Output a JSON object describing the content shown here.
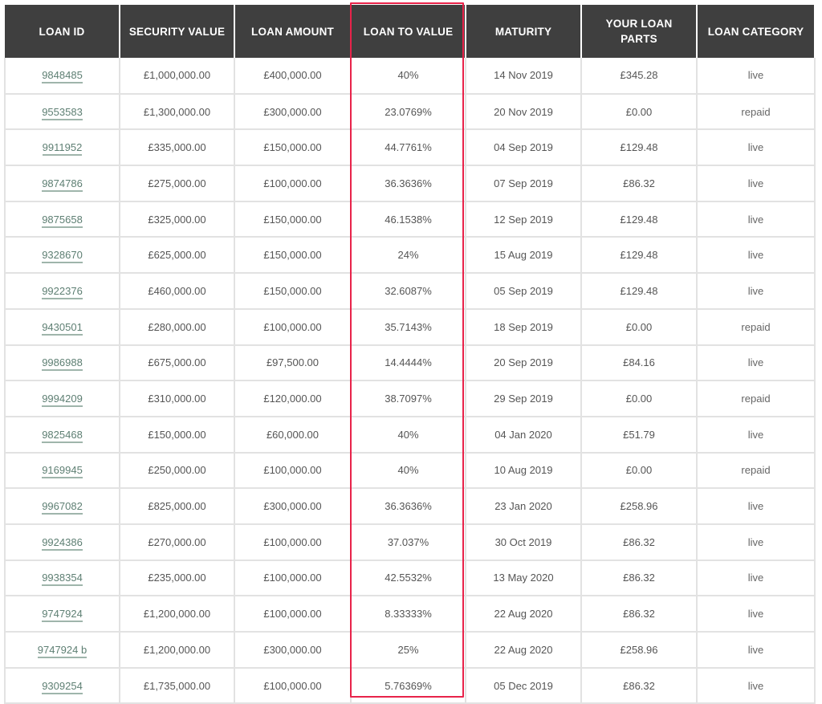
{
  "table": {
    "headers": [
      "LOAN ID",
      "SECURITY VALUE",
      "LOAN AMOUNT",
      "LOAN TO VALUE",
      "MATURITY",
      "YOUR LOAN PARTS",
      "LOAN CATEGORY"
    ],
    "highlighted_column": "LOAN TO VALUE",
    "highlight_color": "#e8234a",
    "header_bg": "#3f3f3f",
    "link_color": "#5e7f73",
    "rows": [
      {
        "loan_id": "9848485",
        "security_value": "£1,000,000.00",
        "loan_amount": "£400,000.00",
        "loan_to_value": "40%",
        "maturity": "14 Nov 2019",
        "your_loan_parts": "£345.28",
        "loan_category": "live"
      },
      {
        "loan_id": "9553583",
        "security_value": "£1,300,000.00",
        "loan_amount": "£300,000.00",
        "loan_to_value": "23.0769%",
        "maturity": "20 Nov 2019",
        "your_loan_parts": "£0.00",
        "loan_category": "repaid"
      },
      {
        "loan_id": "9911952",
        "security_value": "£335,000.00",
        "loan_amount": "£150,000.00",
        "loan_to_value": "44.7761%",
        "maturity": "04 Sep 2019",
        "your_loan_parts": "£129.48",
        "loan_category": "live"
      },
      {
        "loan_id": "9874786",
        "security_value": "£275,000.00",
        "loan_amount": "£100,000.00",
        "loan_to_value": "36.3636%",
        "maturity": "07 Sep 2019",
        "your_loan_parts": "£86.32",
        "loan_category": "live"
      },
      {
        "loan_id": "9875658",
        "security_value": "£325,000.00",
        "loan_amount": "£150,000.00",
        "loan_to_value": "46.1538%",
        "maturity": "12 Sep 2019",
        "your_loan_parts": "£129.48",
        "loan_category": "live"
      },
      {
        "loan_id": "9328670",
        "security_value": "£625,000.00",
        "loan_amount": "£150,000.00",
        "loan_to_value": "24%",
        "maturity": "15 Aug 2019",
        "your_loan_parts": "£129.48",
        "loan_category": "live"
      },
      {
        "loan_id": "9922376",
        "security_value": "£460,000.00",
        "loan_amount": "£150,000.00",
        "loan_to_value": "32.6087%",
        "maturity": "05 Sep 2019",
        "your_loan_parts": "£129.48",
        "loan_category": "live"
      },
      {
        "loan_id": "9430501",
        "security_value": "£280,000.00",
        "loan_amount": "£100,000.00",
        "loan_to_value": "35.7143%",
        "maturity": "18 Sep 2019",
        "your_loan_parts": "£0.00",
        "loan_category": "repaid"
      },
      {
        "loan_id": "9986988",
        "security_value": "£675,000.00",
        "loan_amount": "£97,500.00",
        "loan_to_value": "14.4444%",
        "maturity": "20 Sep 2019",
        "your_loan_parts": "£84.16",
        "loan_category": "live"
      },
      {
        "loan_id": "9994209",
        "security_value": "£310,000.00",
        "loan_amount": "£120,000.00",
        "loan_to_value": "38.7097%",
        "maturity": "29 Sep 2019",
        "your_loan_parts": "£0.00",
        "loan_category": "repaid"
      },
      {
        "loan_id": "9825468",
        "security_value": "£150,000.00",
        "loan_amount": "£60,000.00",
        "loan_to_value": "40%",
        "maturity": "04 Jan 2020",
        "your_loan_parts": "£51.79",
        "loan_category": "live"
      },
      {
        "loan_id": "9169945",
        "security_value": "£250,000.00",
        "loan_amount": "£100,000.00",
        "loan_to_value": "40%",
        "maturity": "10 Aug 2019",
        "your_loan_parts": "£0.00",
        "loan_category": "repaid"
      },
      {
        "loan_id": "9967082",
        "security_value": "£825,000.00",
        "loan_amount": "£300,000.00",
        "loan_to_value": "36.3636%",
        "maturity": "23 Jan 2020",
        "your_loan_parts": "£258.96",
        "loan_category": "live"
      },
      {
        "loan_id": "9924386",
        "security_value": "£270,000.00",
        "loan_amount": "£100,000.00",
        "loan_to_value": "37.037%",
        "maturity": "30 Oct 2019",
        "your_loan_parts": "£86.32",
        "loan_category": "live"
      },
      {
        "loan_id": "9938354",
        "security_value": "£235,000.00",
        "loan_amount": "£100,000.00",
        "loan_to_value": "42.5532%",
        "maturity": "13 May 2020",
        "your_loan_parts": "£86.32",
        "loan_category": "live"
      },
      {
        "loan_id": "9747924",
        "security_value": "£1,200,000.00",
        "loan_amount": "£100,000.00",
        "loan_to_value": "8.33333%",
        "maturity": "22 Aug 2020",
        "your_loan_parts": "£86.32",
        "loan_category": "live"
      },
      {
        "loan_id": "9747924 b",
        "security_value": "£1,200,000.00",
        "loan_amount": "£300,000.00",
        "loan_to_value": "25%",
        "maturity": "22 Aug 2020",
        "your_loan_parts": "£258.96",
        "loan_category": "live"
      },
      {
        "loan_id": "9309254",
        "security_value": "£1,735,000.00",
        "loan_amount": "£100,000.00",
        "loan_to_value": "5.76369%",
        "maturity": "05 Dec 2019",
        "your_loan_parts": "£86.32",
        "loan_category": "live"
      }
    ]
  }
}
